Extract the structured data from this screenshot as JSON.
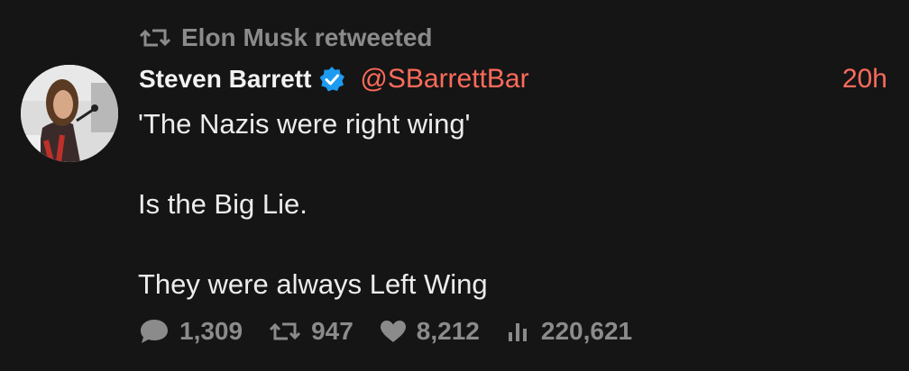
{
  "retweet": {
    "icon": "retweet-icon",
    "text": "Elon Musk retweeted"
  },
  "tweet": {
    "author_name": "Steven Barrett",
    "verified_icon": "verified-badge-icon",
    "handle": "@SBarrettBar",
    "time": "20h",
    "lines": [
      "'The Nazis were right wing'",
      "Is the Big Lie.",
      "They were always Left Wing"
    ]
  },
  "stats": {
    "replies": "1,309",
    "retweets": "947",
    "likes": "8,212",
    "views": "220,621"
  },
  "colors": {
    "background": "#151515",
    "accent": "#ff6b5b",
    "muted": "#8b8b8b",
    "verified": "#1d9bf0"
  }
}
